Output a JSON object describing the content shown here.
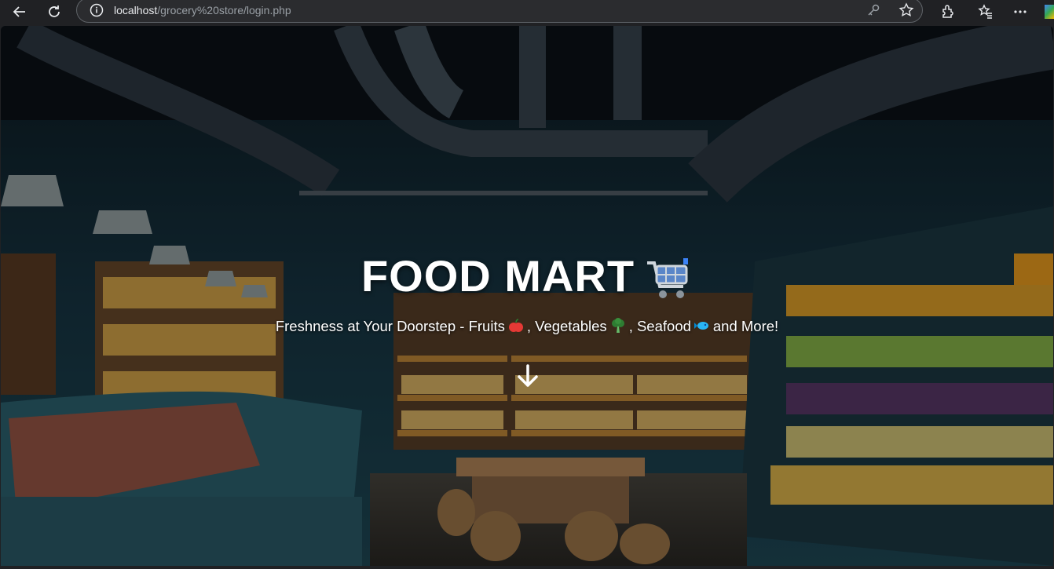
{
  "browser": {
    "url_host": "localhost",
    "url_path": "/grocery%20store/login.php",
    "icons": [
      "back-icon",
      "reload-icon",
      "info-icon",
      "key-icon",
      "star-icon",
      "extensions-icon",
      "favorites-icon",
      "more-icon"
    ]
  },
  "hero": {
    "title": "FOOD MART",
    "subtitle_parts": {
      "p1": "Freshness at Your Doorstep - Fruits",
      "p2": ", Vegetables",
      "p3": ", Seafood",
      "p4": "and More!"
    }
  },
  "colors": {
    "accent_blue": "#3b82f6",
    "text_white": "#ffffff",
    "browser_bg": "#202124"
  }
}
